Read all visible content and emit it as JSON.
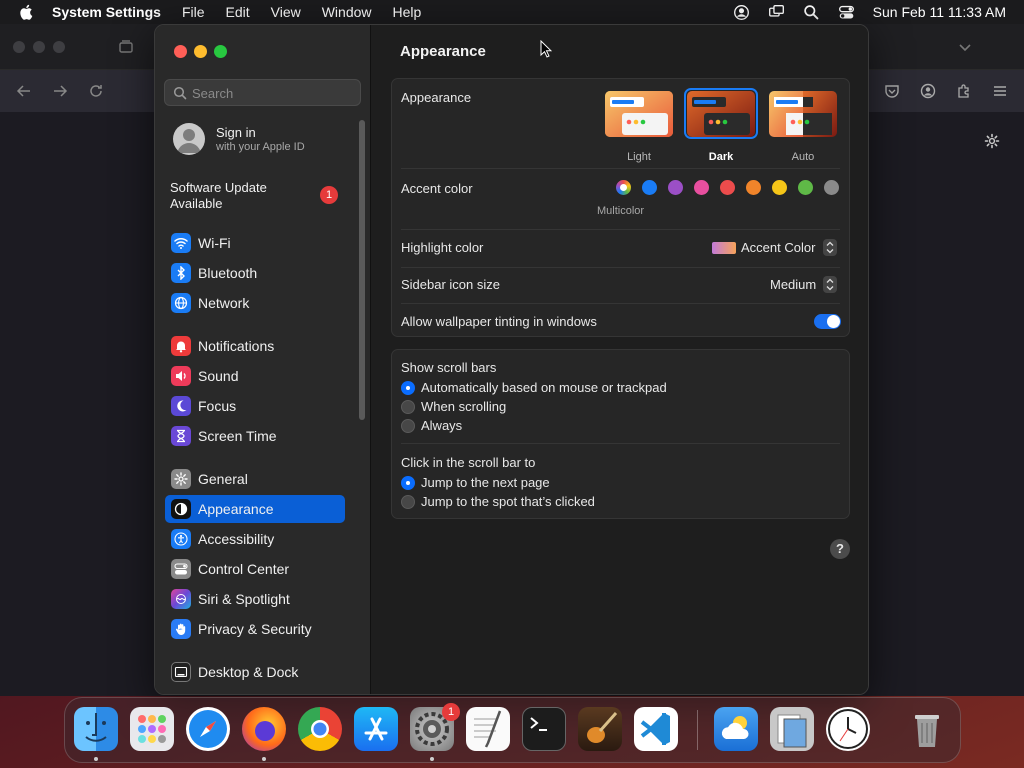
{
  "menubar": {
    "app_name": "System Settings",
    "menus": [
      "File",
      "Edit",
      "View",
      "Window",
      "Help"
    ],
    "clock": "Sun Feb 11  11:33 AM"
  },
  "sidebar": {
    "search_placeholder": "Search",
    "account": {
      "title": "Sign in",
      "subtitle": "with your Apple ID"
    },
    "update": {
      "label_line1": "Software Update",
      "label_line2": "Available",
      "badge": "1"
    },
    "items": [
      {
        "label": "Wi-Fi",
        "icon": "wifi-icon",
        "color": "#1a7cf5"
      },
      {
        "label": "Bluetooth",
        "icon": "bluetooth-icon",
        "color": "#1a7cf5"
      },
      {
        "label": "Network",
        "icon": "globe-icon",
        "color": "#1a7cf5"
      },
      {
        "label": "Notifications",
        "icon": "bell-icon",
        "color": "#ee3b3b"
      },
      {
        "label": "Sound",
        "icon": "speaker-icon",
        "color": "#ee3b5a"
      },
      {
        "label": "Focus",
        "icon": "moon-icon",
        "color": "#5b49d6"
      },
      {
        "label": "Screen Time",
        "icon": "hourglass-icon",
        "color": "#6a48d6"
      },
      {
        "label": "General",
        "icon": "gear-icon",
        "color": "#8a8a8a"
      },
      {
        "label": "Appearance",
        "icon": "appearance-icon",
        "color": "#111111"
      },
      {
        "label": "Accessibility",
        "icon": "accessibility-icon",
        "color": "#1a7cf5"
      },
      {
        "label": "Control Center",
        "icon": "control-center-icon",
        "color": "#8a8a8a"
      },
      {
        "label": "Siri & Spotlight",
        "icon": "siri-icon",
        "color": "#b04ad0"
      },
      {
        "label": "Privacy & Security",
        "icon": "hand-icon",
        "color": "#2a7cf5"
      },
      {
        "label": "Desktop & Dock",
        "icon": "dock-icon",
        "color": "#222222"
      }
    ],
    "selected": "Appearance"
  },
  "main": {
    "title": "Appearance",
    "appearance": {
      "label": "Appearance",
      "options": [
        "Light",
        "Dark",
        "Auto"
      ],
      "selected": "Dark"
    },
    "accent": {
      "label": "Accent color",
      "selected_name": "Multicolor",
      "colors": [
        "#ffffff",
        "#1a7cf5",
        "#9b4fc6",
        "#e84f9f",
        "#ec4c4c",
        "#f0842a",
        "#f5c518",
        "#5fb947",
        "#8a8a8a"
      ]
    },
    "highlight": {
      "label": "Highlight color",
      "value": "Accent Color"
    },
    "sidebar_icon_size": {
      "label": "Sidebar icon size",
      "value": "Medium"
    },
    "wallpaper_tinting": {
      "label": "Allow wallpaper tinting in windows",
      "on": true
    },
    "scroll_bars": {
      "label": "Show scroll bars",
      "options": [
        "Automatically based on mouse or trackpad",
        "When scrolling",
        "Always"
      ],
      "selected": 0
    },
    "click_scroll": {
      "label": "Click in the scroll bar to",
      "options": [
        "Jump to the next page",
        "Jump to the spot that’s clicked"
      ],
      "selected": 0
    },
    "help": "?"
  },
  "dock": {
    "apps": [
      "Finder",
      "Launchpad",
      "Safari",
      "Firefox",
      "Chrome",
      "App Store",
      "System Settings",
      "TextEdit",
      "Terminal",
      "GarageBand",
      "VS Code",
      "Weather",
      "Preview",
      "Clock",
      "Trash"
    ],
    "settings_badge": "1"
  }
}
